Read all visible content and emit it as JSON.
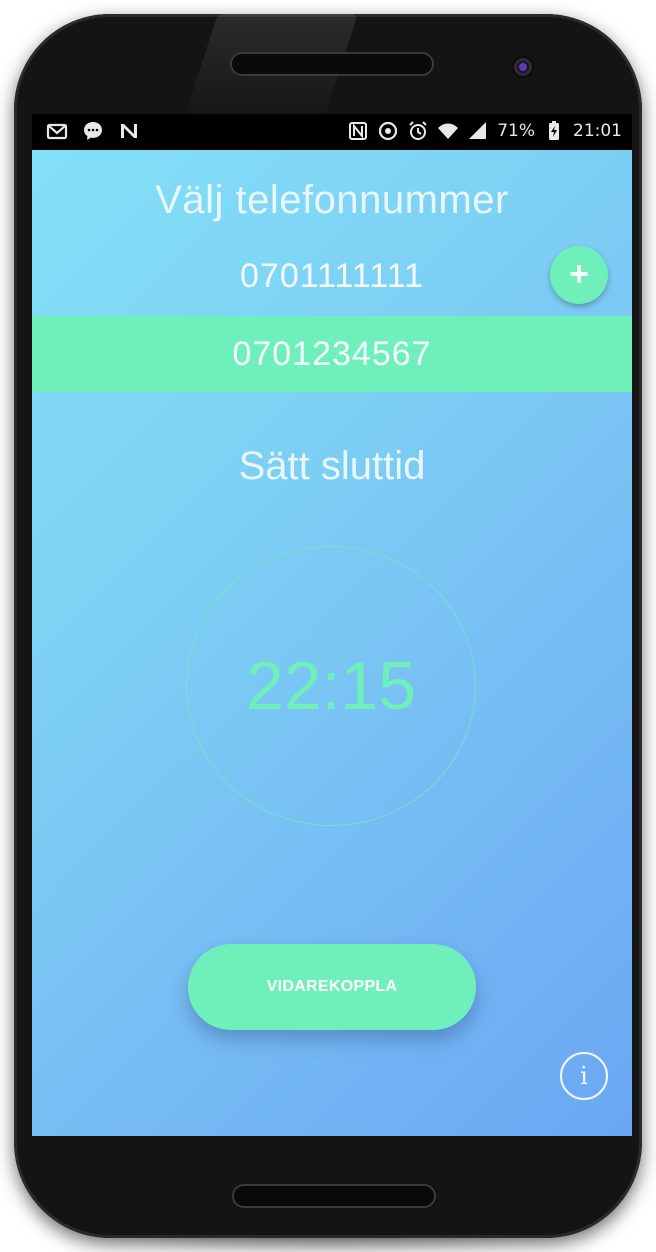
{
  "status_bar": {
    "left_icons": [
      "gmail-icon",
      "messenger-icon",
      "n-app-icon"
    ],
    "right_icons": [
      "nfc-icon",
      "do-not-disturb-icon",
      "alarm-icon",
      "wifi-icon",
      "signal-icon"
    ],
    "battery_percent": "71%",
    "time": "21:01"
  },
  "app": {
    "title": "Välj telefonnummer",
    "phone_numbers": [
      {
        "number": "0701111111",
        "selected": false
      },
      {
        "number": "0701234567",
        "selected": true
      }
    ],
    "add_button_label": "+",
    "end_time_title": "Sätt sluttid",
    "end_time": "22:15",
    "forward_button_label": "VIDAREKOPPLA",
    "info_button_label": "i"
  },
  "colors": {
    "accent": "#6ff0bb",
    "gradient_start": "#83e0f7",
    "gradient_end": "#6aa6f3"
  }
}
